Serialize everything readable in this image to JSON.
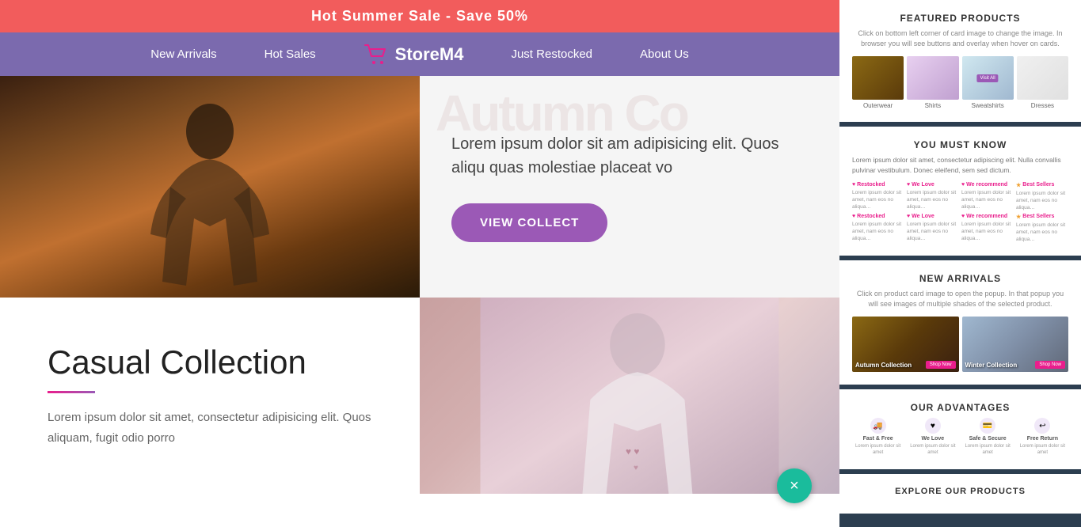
{
  "banner": {
    "text": "Hot Summer Sale - Save 50%"
  },
  "navbar": {
    "logo": "StoreM4",
    "links": [
      "New Arrivals",
      "Hot Sales",
      "Just Restocked",
      "About Us"
    ]
  },
  "hero_top": {
    "autumn_text": "Autumn Co",
    "lorem_text": "Lorem ipsum dolor sit am adipisicing elit. Quos aliqu quas molestiae placeat vo",
    "button_label": "VIEW COLLECT"
  },
  "hero_bottom": {
    "heading": "Casual Collection",
    "paragraph": "Lorem ipsum dolor sit amet, consectetur adipisicing elit. Quos aliquam, fugit odio porro"
  },
  "right_panel": {
    "featured_products": {
      "title": "FEATURED PRODUCTS",
      "subtitle": "Click on bottom left corner of card image to change the image. In browser you will see buttons and overlay when hover on cards.",
      "items": [
        {
          "label": "Outerwear",
          "type": "outerwear"
        },
        {
          "label": "Shirts",
          "type": "shirts"
        },
        {
          "label": "Sweatshirts",
          "type": "sweatshirts",
          "badge": "Visit All"
        },
        {
          "label": "Dresses",
          "type": "dresses"
        }
      ]
    },
    "you_must_know": {
      "title": "YOU MUST KNOW",
      "intro": "Lorem ipsum dolor sit amet, consectetur adipiscing elit. Nulla convallis pulvinar vestibulum. Donec eleifend, sem sed dictum.",
      "items": [
        {
          "label": "Restocked",
          "icon": "♥",
          "text": "Lorem ipsum dolor sit amet, nam eos no aliqua namuet, non loco, accumsant possit…"
        },
        {
          "label": "We Love",
          "icon": "♥",
          "text": "Lorem ipsum dolor sit amet, nam eos no aliqua namuet, non loco, accumsant possit…"
        },
        {
          "label": "We recommend",
          "icon": "♥",
          "text": "Lorem ipsum dolor sit amet, nam eos no aliqua namuet, non loco, accumsant possit…"
        },
        {
          "label": "Best Sellers",
          "icon": "★",
          "text": "Lorem ipsum dolor sit amet, nam eos no aliqua namuet, non loco, accumsant possit…"
        },
        {
          "label": "Restocked",
          "icon": "♥",
          "text": "Lorem ipsum dolor sit amet, nam eos no aliqua namuet, non loco, accumsant possit…"
        },
        {
          "label": "We Love",
          "icon": "♥",
          "text": "Lorem ipsum dolor sit amet, nam eos no aliqua namuet, non loco, accumsant possit…"
        },
        {
          "label": "We recommend",
          "icon": "♥",
          "text": "Lorem ipsum dolor sit amet, nam eos no aliqua namuet, non loco, accumsant possit…"
        },
        {
          "label": "Best Sellers",
          "icon": "★",
          "text": "Lorem ipsum dolor sit amet, nam eos no aliqua namuet, non loco, accumsant possit…"
        }
      ]
    },
    "new_arrivals": {
      "title": "NEW ARRIVALS",
      "subtitle": "Click on product card image to open the popup. In that popup you will see images of multiple shades of the selected product.",
      "items": [
        {
          "label": "Autumn Collection",
          "type": "autumn",
          "btn": "Shop Now"
        },
        {
          "label": "Winter Collection",
          "type": "winter",
          "btn": "Shop Now"
        }
      ]
    },
    "our_advantages": {
      "title": "OUR ADVANTAGES",
      "items": [
        {
          "icon": "🚚",
          "title": "Fast & Free",
          "text": "Lorem ipsum dolor sit amet"
        },
        {
          "icon": "♥",
          "title": "We Love",
          "text": "Lorem ipsum dolor sit amet"
        },
        {
          "icon": "💳",
          "title": "Safe & Secure",
          "text": "Lorem ipsum dolor sit amet"
        },
        {
          "icon": "↩",
          "title": "Free Return",
          "text": "Lorem ipsum dolor sit amet"
        }
      ]
    },
    "explore_products": {
      "title": "EXPLORE OUR PRODUCTS"
    }
  },
  "close_button": "×"
}
